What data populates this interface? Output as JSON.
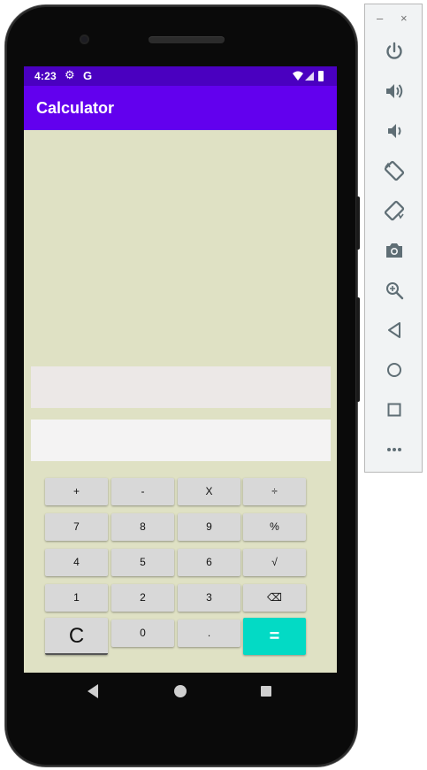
{
  "status_bar": {
    "time": "4:23",
    "g_icon": "G"
  },
  "app": {
    "title": "Calculator"
  },
  "display": {
    "expression": "",
    "result": ""
  },
  "keys": {
    "row1": [
      "+",
      "-",
      "X",
      "÷"
    ],
    "row2": [
      "7",
      "8",
      "9",
      "%"
    ],
    "row3": [
      "4",
      "5",
      "6",
      "√"
    ],
    "row4": [
      "1",
      "2",
      "3",
      "⌫"
    ],
    "row5": [
      "C",
      "0",
      ".",
      "="
    ]
  },
  "toolbar": {
    "minimize": "–",
    "close": "×",
    "icons": [
      "power-icon",
      "volume-up-icon",
      "volume-down-icon",
      "rotate-left-icon",
      "rotate-right-icon",
      "camera-icon",
      "zoom-icon",
      "back-icon",
      "home-icon",
      "overview-icon",
      "more-icon"
    ]
  },
  "colors": {
    "status_bar": "#4a00c0",
    "app_bar": "#6200ee",
    "background": "#dfe1c4",
    "equals": "#03dac5",
    "key": "#d8d8d8"
  }
}
